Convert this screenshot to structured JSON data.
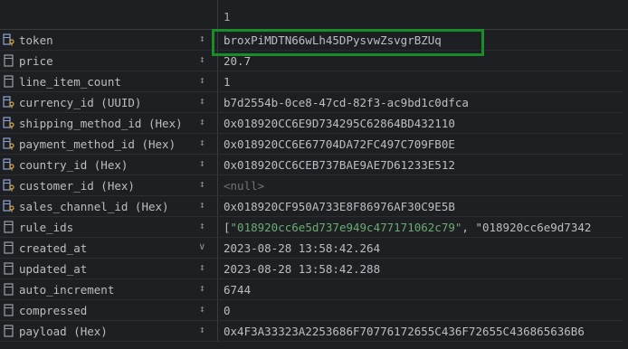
{
  "header": {
    "column_label": "1"
  },
  "rows": [
    {
      "name": "token",
      "icon": "key-column-icon",
      "value": "broxPiMDTN66wLh45DPysvwZsvgrBZUq",
      "sort": "↕"
    },
    {
      "name": "price",
      "icon": "column-icon",
      "value": "20.7",
      "sort": "↕"
    },
    {
      "name": "line_item_count",
      "icon": "column-icon",
      "value": "1",
      "sort": "↕"
    },
    {
      "name": "currency_id (UUID)",
      "icon": "key-column-icon",
      "value": "b7d2554b-0ce8-47cd-82f3-ac9bd1c0dfca",
      "sort": "↕"
    },
    {
      "name": "shipping_method_id (Hex)",
      "icon": "key-column-icon",
      "value": "0x018920CC6E9D734295C62864BD432110",
      "sort": "↕"
    },
    {
      "name": "payment_method_id (Hex)",
      "icon": "key-column-icon",
      "value": "0x018920CC6E67704DA72FC497C709FB0E",
      "sort": "↕"
    },
    {
      "name": "country_id (Hex)",
      "icon": "key-column-icon",
      "value": "0x018920CC6CEB737BAE9AE7D61233E512",
      "sort": "↕"
    },
    {
      "name": "customer_id (Hex)",
      "icon": "key-column-icon",
      "value": "<null>",
      "sort": "↕",
      "null": true
    },
    {
      "name": "sales_channel_id (Hex)",
      "icon": "key-column-icon",
      "value": "0x018920CF950A733E8F86976AF30C9E5B",
      "sort": "↕"
    },
    {
      "name": "rule_ids",
      "icon": "column-icon",
      "value": "[\"018920cc6e5d737e949c477171062c79\", \"018920cc6e9d7342",
      "sort": "↕",
      "json": true
    },
    {
      "name": "created_at",
      "icon": "column-icon",
      "value": "2023-08-28 13:58:42.264",
      "sort": "∨"
    },
    {
      "name": "updated_at",
      "icon": "column-icon",
      "value": "2023-08-28 13:58:42.288",
      "sort": "↕"
    },
    {
      "name": "auto_increment",
      "icon": "column-icon",
      "value": "6744",
      "sort": "↕"
    },
    {
      "name": "compressed",
      "icon": "column-icon",
      "value": "0",
      "sort": "↕"
    },
    {
      "name": "payload (Hex)",
      "icon": "column-icon",
      "value": "0x4F3A33323A2253686F70776172655C436F72655C436865636B6",
      "sort": "↕"
    }
  ],
  "colors": {
    "highlight_border": "#1a8c28",
    "json_string": "#6aab73",
    "null_text": "#6f737a"
  }
}
